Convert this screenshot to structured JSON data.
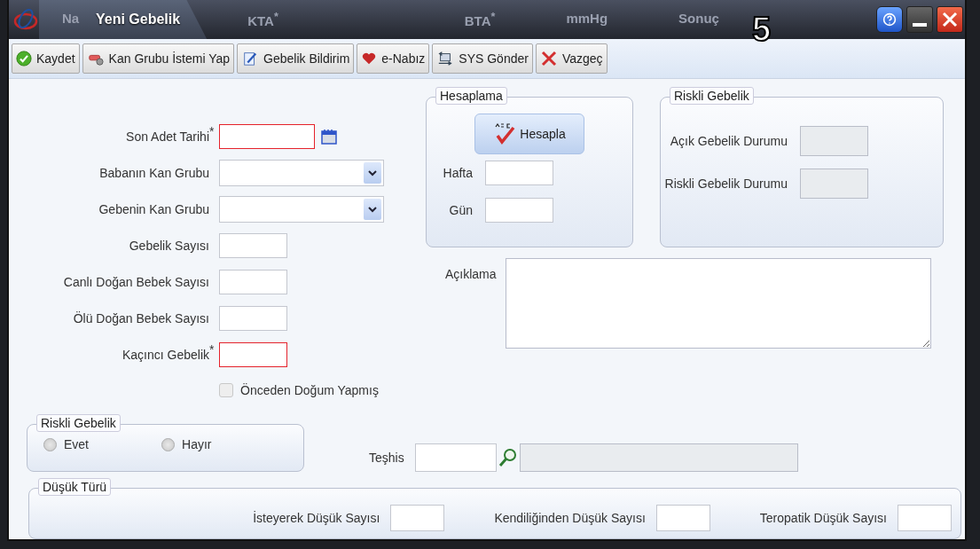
{
  "window": {
    "title": "Yeni Gebelik",
    "badge": "5"
  },
  "background_labels": [
    {
      "text": "Na"
    },
    {
      "text": "KTA",
      "mark": "*"
    },
    {
      "text": "BTA",
      "mark": "*"
    },
    {
      "text": "mmHg"
    },
    {
      "text": "Sonuç"
    }
  ],
  "toolbar": [
    {
      "label": "Kaydet",
      "kind": "save"
    },
    {
      "label": "Kan Grubu İstemi Yap",
      "kind": "blood"
    },
    {
      "label": "Gebelik Bildirim",
      "kind": "report"
    },
    {
      "label": "e-Nabız",
      "kind": "heart"
    },
    {
      "label": "SYS Gönder",
      "kind": "send"
    },
    {
      "label": "Vazgeç",
      "kind": "cancel"
    }
  ],
  "form": {
    "required_mark": "*",
    "fields": [
      {
        "label": "Son Adet Tarihi",
        "kind": "date",
        "required": true
      },
      {
        "label": "Babanın Kan Grubu",
        "kind": "select",
        "required": false
      },
      {
        "label": "Gebenin Kan Grubu",
        "kind": "select",
        "required": false
      },
      {
        "label": "Gebelik Sayısı",
        "kind": "text",
        "required": false
      },
      {
        "label": "Canlı Doğan Bebek Sayısı",
        "kind": "text",
        "required": false
      },
      {
        "label": "Ölü Doğan Bebek Sayısı",
        "kind": "text",
        "required": false
      },
      {
        "label": "Kaçıncı Gebelik",
        "kind": "text",
        "required": true
      }
    ]
  },
  "previous_birth": {
    "label": "Önceden Doğum Yapmış",
    "checked": false,
    "disabled": true
  },
  "calculation": {
    "title": "Hesaplama",
    "button": "Hesapla",
    "fields": [
      "Hafta",
      "Gün"
    ]
  },
  "risk_status": {
    "title": "Riskli Gebelik",
    "fields": [
      "Açık Gebelik Durumu",
      "Riskli Gebelik Durumu"
    ]
  },
  "description": {
    "label": "Açıklama"
  },
  "risky_pregnancy": {
    "title": "Riskli Gebelik",
    "options": [
      {
        "label": "Evet",
        "selected": false
      },
      {
        "label": "Hayır",
        "selected": false
      }
    ]
  },
  "diagnosis": {
    "label": "Teşhis"
  },
  "miscarriage": {
    "title": "Düşük Türü",
    "fields": [
      "İsteyerek Düşük Sayısı",
      "Kendiliğinden Düşük Sayısı",
      "Teropatik Düşük Sayısı"
    ]
  }
}
